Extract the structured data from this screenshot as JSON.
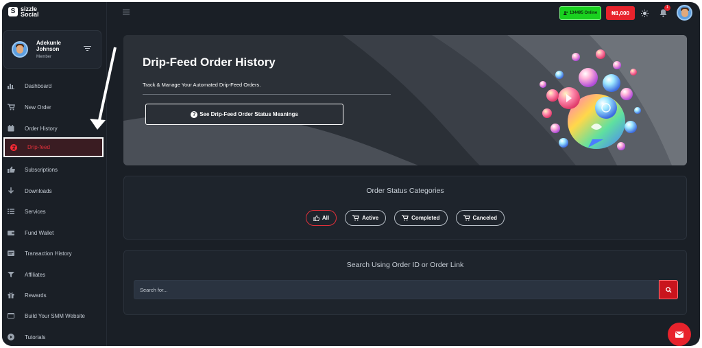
{
  "brand": {
    "name": "sizzle Social",
    "line1": "sizzle",
    "line2": "Social"
  },
  "user": {
    "name": "Adekunle Johnson",
    "role": "Member"
  },
  "sidebar": {
    "items": [
      {
        "label": "Dashboard",
        "icon": "chart-icon"
      },
      {
        "label": "New Order",
        "icon": "cart-icon"
      },
      {
        "label": "Order History",
        "icon": "calendar-icon"
      },
      {
        "label": "Drip-feed",
        "icon": "drip-icon",
        "active": true
      },
      {
        "label": "Subscriptions",
        "icon": "thumbs-up-icon"
      },
      {
        "label": "Downloads",
        "icon": "download-icon"
      },
      {
        "label": "Services",
        "icon": "list-icon"
      },
      {
        "label": "Fund Wallet",
        "icon": "wallet-icon"
      },
      {
        "label": "Transaction History",
        "icon": "history-icon"
      },
      {
        "label": "Affiliates",
        "icon": "affiliate-icon"
      },
      {
        "label": "Rewards",
        "icon": "gift-icon"
      },
      {
        "label": "Build Your SMM Website",
        "icon": "website-icon"
      },
      {
        "label": "Tutorials",
        "icon": "play-icon"
      }
    ]
  },
  "topbar": {
    "online_label": "134495 Online",
    "balance": "₦1,000",
    "notifications_count": "1"
  },
  "hero": {
    "title": "Drip-Feed Order History",
    "subtitle": "Track & Manage Your Automated Drip-Feed Orders.",
    "button_label": "See Drip-Feed Order Status Meanings"
  },
  "status": {
    "title": "Order Status Categories",
    "filters": [
      {
        "label": "All",
        "icon": "thumbs-up-icon",
        "active": true
      },
      {
        "label": "Active",
        "icon": "cart-icon"
      },
      {
        "label": "Completed",
        "icon": "cart-icon"
      },
      {
        "label": "Canceled",
        "icon": "cart-icon"
      }
    ]
  },
  "search": {
    "title": "Search Using Order ID or Order Link",
    "placeholder": "Search for..."
  },
  "colors": {
    "accent": "#e8232c",
    "online": "#19d11f",
    "bg": "#1a1f26",
    "card": "#1e242c"
  }
}
